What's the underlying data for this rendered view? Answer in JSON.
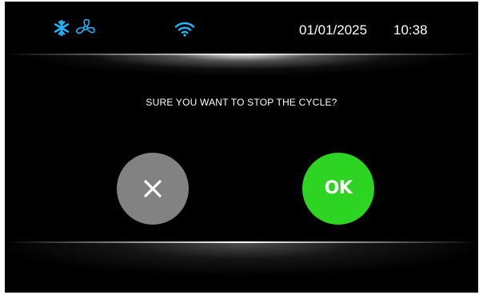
{
  "status_bar": {
    "icons": [
      "snowflake-icon",
      "fan-icon",
      "wifi-icon"
    ],
    "icon_color": "#1fb6ff",
    "date": "01/01/2025",
    "time": "10:38"
  },
  "dialog": {
    "prompt": "SURE YOU WANT TO STOP THE CYCLE?",
    "cancel_icon": "close-icon",
    "cancel_color": "#828282",
    "ok_label": "OK",
    "ok_color": "#2dd421"
  }
}
